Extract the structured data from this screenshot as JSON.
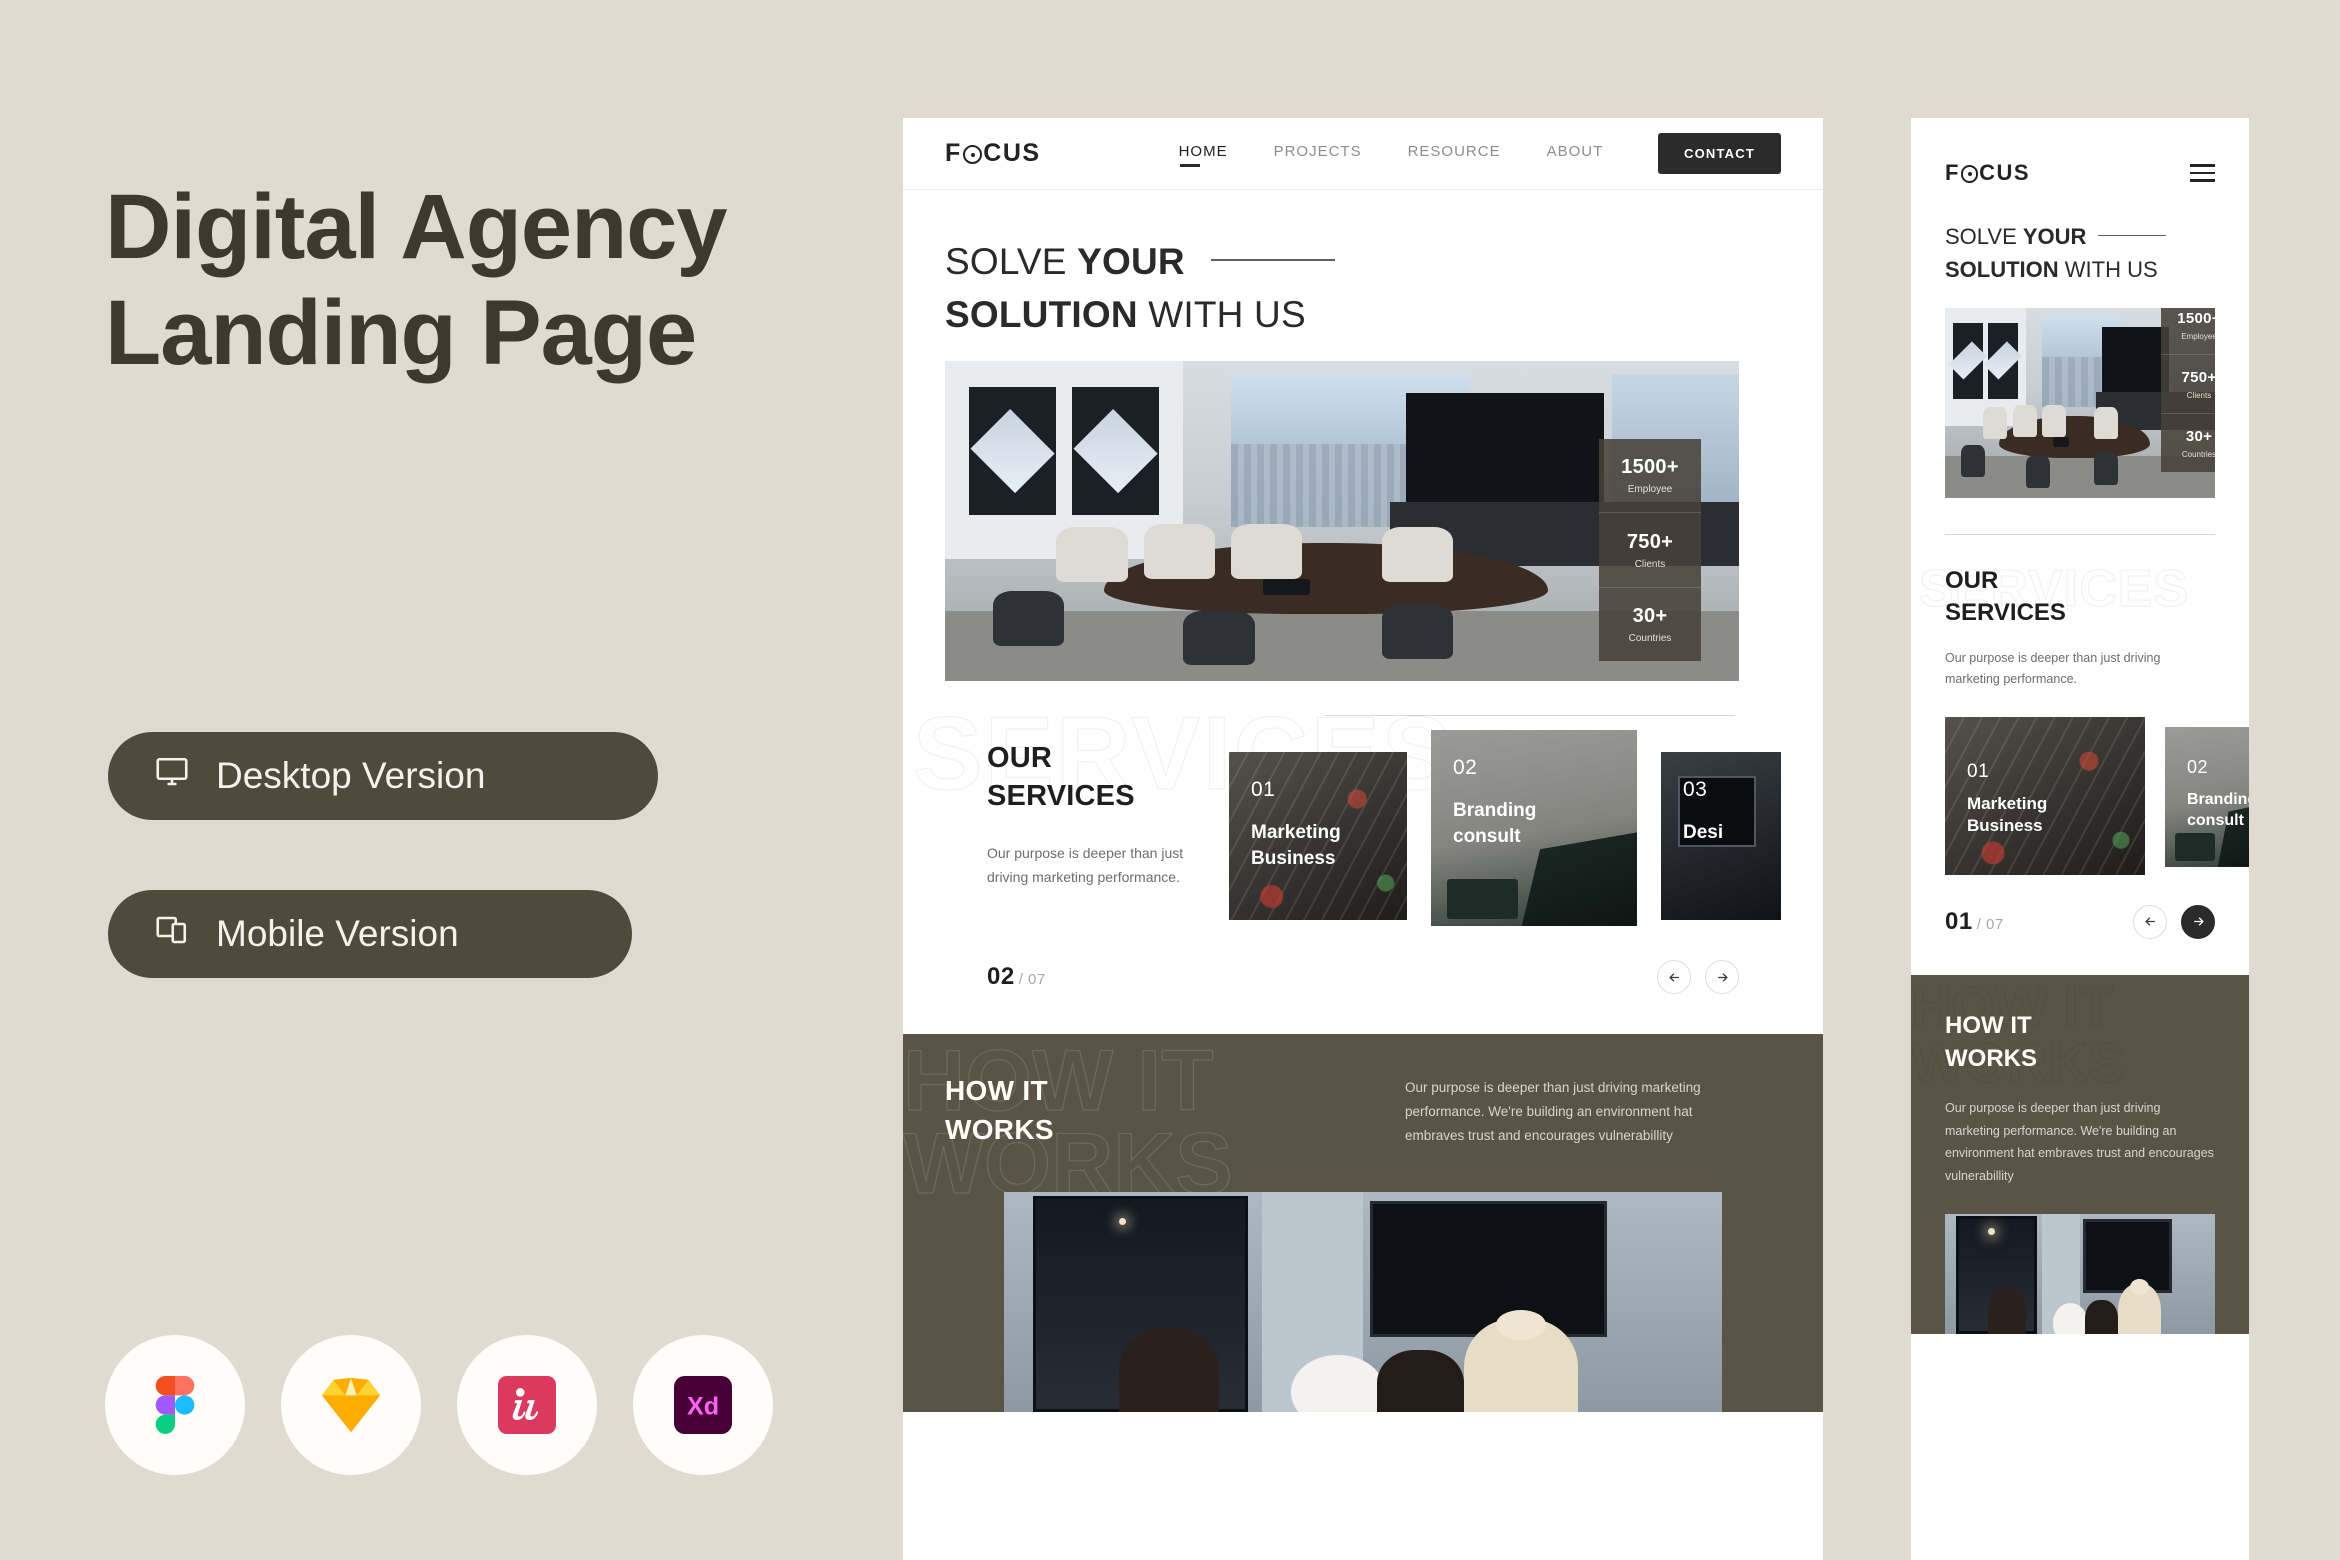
{
  "theme": {
    "background": "#E0DAD0",
    "title_color": "#3E382F",
    "button_bg": "#504A3D",
    "dark_section": "#5A5447",
    "accent_dark": "#2B2B2B"
  },
  "left_panel": {
    "title_line1": "Digital Agency",
    "title_line2": "Landing Page",
    "buttons": [
      {
        "label": "Desktop Version",
        "icon": "monitor-icon"
      },
      {
        "label": "Mobile Version",
        "icon": "devices-icon"
      }
    ],
    "app_icons": [
      {
        "name": "figma-icon",
        "label": "Figma"
      },
      {
        "name": "sketch-icon",
        "label": "Sketch"
      },
      {
        "name": "invision-icon",
        "label": "InVision"
      },
      {
        "name": "adobe-xd-icon",
        "label": "Adobe XD"
      }
    ]
  },
  "site": {
    "logo": {
      "pre": "F",
      "o": "O",
      "post": "CUS"
    },
    "nav": [
      {
        "label": "HOME",
        "active": true
      },
      {
        "label": "PROJECTS",
        "active": false
      },
      {
        "label": "RESOURCE",
        "active": false
      },
      {
        "label": "ABOUT",
        "active": false
      }
    ],
    "contact_button": "CONTACT",
    "hero": {
      "line1_light": "SOLVE ",
      "line1_bold": "YOUR",
      "line2_bold": "SOLUTION",
      "line2_light": " WITH US",
      "stats": [
        {
          "number": "1500+",
          "label": "Employee"
        },
        {
          "number": "750+",
          "label": "Clients"
        },
        {
          "number": "30+",
          "label": "Countries"
        }
      ]
    },
    "services": {
      "watermark": "SERVICES",
      "title_line1": "OUR",
      "title_line2": "SERVICES",
      "description_desktop": "Our purpose is deeper than just driving marketing performance.",
      "description_mobile": "Our purpose is deeper than just driving marketing performance.",
      "cards": [
        {
          "number": "01",
          "title_line1": "Marketing",
          "title_line2": "Business",
          "art": "art-marketing"
        },
        {
          "number": "02",
          "title_line1": "Branding",
          "title_line2": "consult",
          "art": "art-branding"
        },
        {
          "number": "03",
          "title_line1": "Desi",
          "title_line2": "",
          "art": "art-design"
        }
      ],
      "pager_desktop": {
        "current": "02",
        "total": "/ 07"
      },
      "pager_mobile": {
        "current": "01",
        "total": "/ 07"
      },
      "prev_icon": "arrow-left-icon",
      "next_icon": "arrow-right-icon"
    },
    "how_it_works": {
      "watermark_line1": "HOW IT",
      "watermark_line2": "WORKS",
      "title_line1": "HOW IT",
      "title_line2": "WORKS",
      "description": "Our purpose is deeper than just driving marketing performance. We're building an environment hat embraves trust and encourages vulnerabillity"
    }
  }
}
